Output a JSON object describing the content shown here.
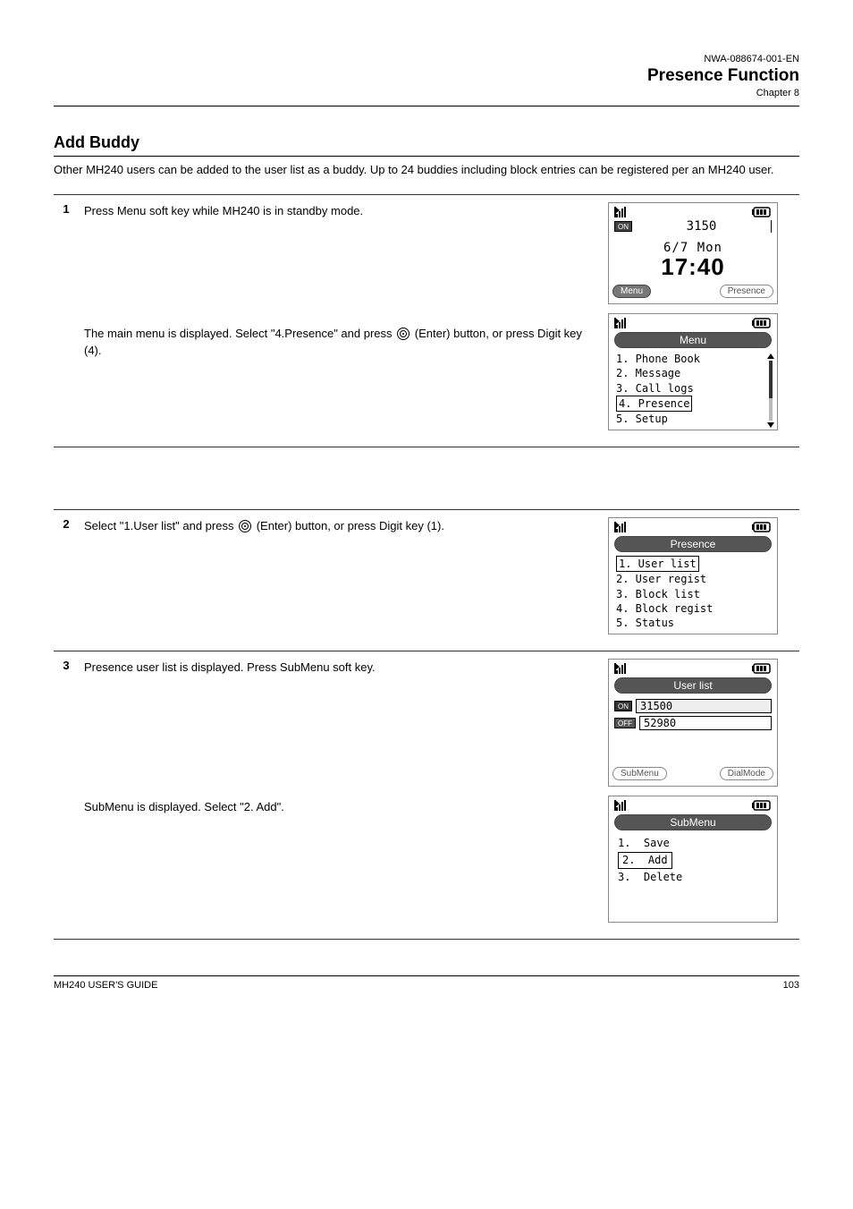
{
  "header": {
    "doc_id": "NWA-088674-001-EN",
    "title": "Presence Function",
    "chapter": "Chapter 8"
  },
  "section_title": "Add Buddy",
  "intro": "Other MH240 users can be added to the user list as a buddy. Up to 24 buddies including block entries can be registered per an MH240 user.",
  "steps": {
    "s1": {
      "num": "1",
      "p1": "Press Menu soft key while MH240 is in standby mode.",
      "p2_a": "The main menu is displayed. Select \"4.Presence\" and press",
      "p2_b": "(Enter) button, or press Digit key (4)."
    },
    "s2": {
      "num": "2",
      "p_a": "Select \"1.User list\" and press",
      "p_b": "(Enter) button, or press Digit key (1)."
    },
    "s3": {
      "num": "3",
      "p1": "Presence user list is displayed. Press SubMenu soft key.",
      "p2": "SubMenu is displayed. Select \"2. Add\"."
    }
  },
  "screens": {
    "home": {
      "on": "ON",
      "id": "3150",
      "date": "6/7 Mon",
      "time": "17:40",
      "sk_left": "Menu",
      "sk_right": "Presence"
    },
    "mainmenu": {
      "title": "Menu",
      "items": [
        "1. Phone Book",
        "2. Message",
        "3. Call logs",
        "4. Presence",
        "5. Setup"
      ],
      "sel_index": 3
    },
    "presence": {
      "title": "Presence",
      "items": [
        "1. User list",
        "2. User regist",
        "3. Block list",
        "4. Block regist",
        "5. Status"
      ],
      "sel_index": 0
    },
    "userlist": {
      "title": "User list",
      "rows": [
        {
          "badge": "ON",
          "val": "31500"
        },
        {
          "badge": "OFF",
          "val": "52980"
        }
      ],
      "sk_left": "SubMenu",
      "sk_right": "DialMode"
    },
    "submenu": {
      "title": "SubMenu",
      "items": [
        "1.  Save",
        "2.  Add",
        "3.  Delete"
      ],
      "sel_index": 1
    }
  },
  "footer": {
    "left": "MH240 USER'S GUIDE",
    "right": "103"
  }
}
